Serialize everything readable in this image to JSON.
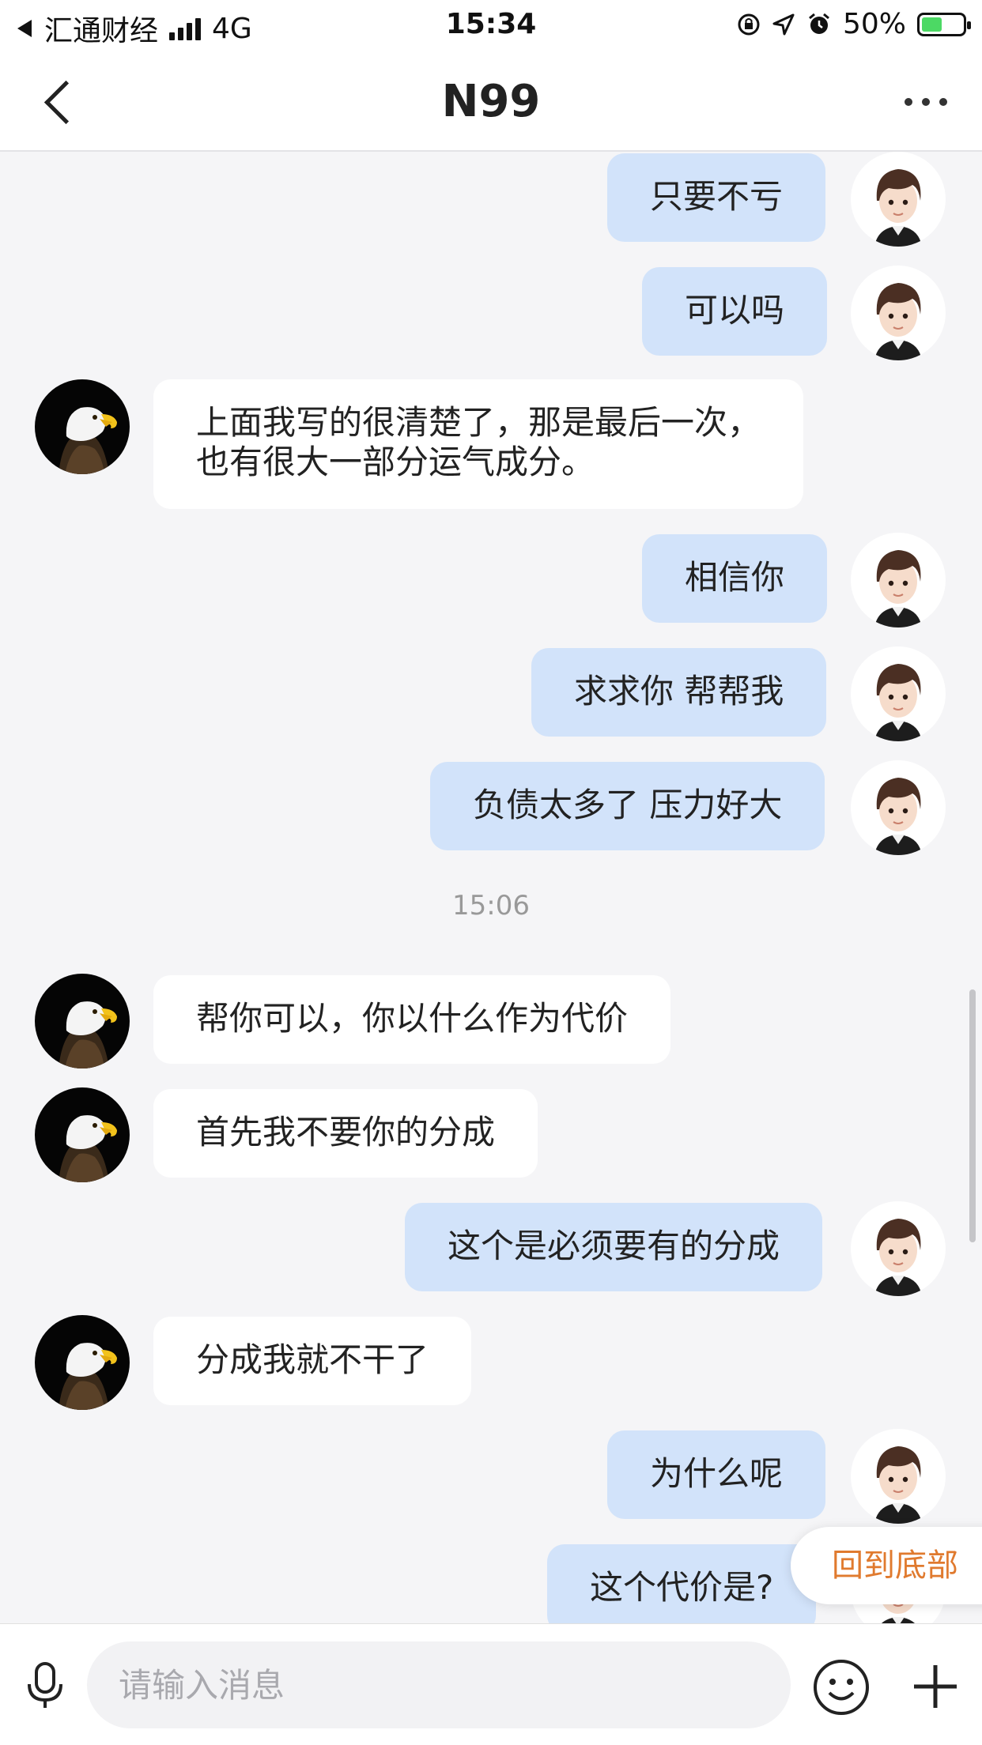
{
  "status_bar": {
    "carrier": "汇通财经",
    "network": "4G",
    "time": "15:34",
    "battery": "50%",
    "battery_fraction": 0.5
  },
  "header": {
    "title": "N99"
  },
  "messages": [
    {
      "side": "me",
      "text": "只要不亏"
    },
    {
      "side": "me",
      "text": "可以吗"
    },
    {
      "side": "them",
      "lines": [
        "上面我写的很清楚了，那是最后一次，",
        "也有很大一部分运气成分。"
      ]
    },
    {
      "side": "me",
      "text": "相信你"
    },
    {
      "side": "me",
      "text": "求求你 帮帮我"
    },
    {
      "side": "me",
      "text": "负债太多了 压力好大"
    },
    {
      "type": "timestamp",
      "text": "15:06"
    },
    {
      "side": "them",
      "text": "帮你可以，你以什么作为代价"
    },
    {
      "side": "them",
      "text": "首先我不要你的分成"
    },
    {
      "side": "me",
      "text": "这个是必须要有的分成"
    },
    {
      "side": "them",
      "text": "分成我就不干了"
    },
    {
      "side": "me",
      "text": "为什么呢"
    },
    {
      "side": "me",
      "text": "这个代价是?"
    }
  ],
  "back_to_bottom": "回到底部",
  "input": {
    "placeholder": "请输入消息"
  },
  "colors": {
    "my_bubble": "#d2e3fa",
    "their_bubble": "#ffffff",
    "background": "#f5f5f7",
    "accent": "#e07a2e"
  }
}
